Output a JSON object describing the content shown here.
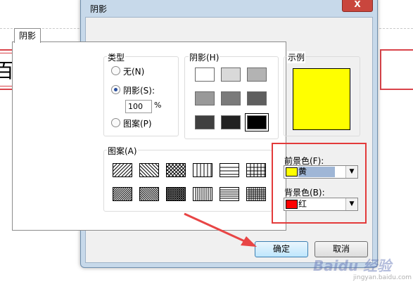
{
  "background_doc": {
    "text": "百度账号"
  },
  "dialog": {
    "title": "阴影",
    "close_label": "X",
    "tab_label": "阴影"
  },
  "type_group": {
    "label": "类型",
    "options": [
      {
        "label": "无(N)",
        "selected": false
      },
      {
        "label": "阴影(S):",
        "selected": true
      },
      {
        "label": "图案(P)",
        "selected": false
      }
    ],
    "percent_value": "100",
    "percent_sign": "%"
  },
  "shade_group": {
    "label": "阴影(H)",
    "swatches": [
      "#ffffff",
      "#d9d9d9",
      "#b3b3b3",
      "#999999",
      "#7a7a7a",
      "#5e5e5e",
      "#404040",
      "#222222",
      "#000000"
    ],
    "selected_index": 8
  },
  "sample_group": {
    "label": "示例",
    "fill_color": "#ffff00"
  },
  "pattern_group": {
    "label": "图案(A)",
    "patterns": [
      "diag-up-wide",
      "diag-down-wide",
      "diag-cross",
      "vertical",
      "horizontal",
      "grid",
      "diag-up-dense",
      "diag-down-dense",
      "diag-cross-dense",
      "vertical-dense",
      "horizontal-dense",
      "grid-dense"
    ]
  },
  "colors": {
    "foreground_label": "前景色(F):",
    "foreground_value": "黄",
    "foreground_color": "#ffff00",
    "background_label": "背景色(B):",
    "background_value": "红",
    "background_color": "#ff0000"
  },
  "buttons": {
    "ok": "确定",
    "cancel": "取消"
  },
  "watermark": {
    "logo": "Baidu 经验",
    "url": "jingyan.baidu.com"
  }
}
